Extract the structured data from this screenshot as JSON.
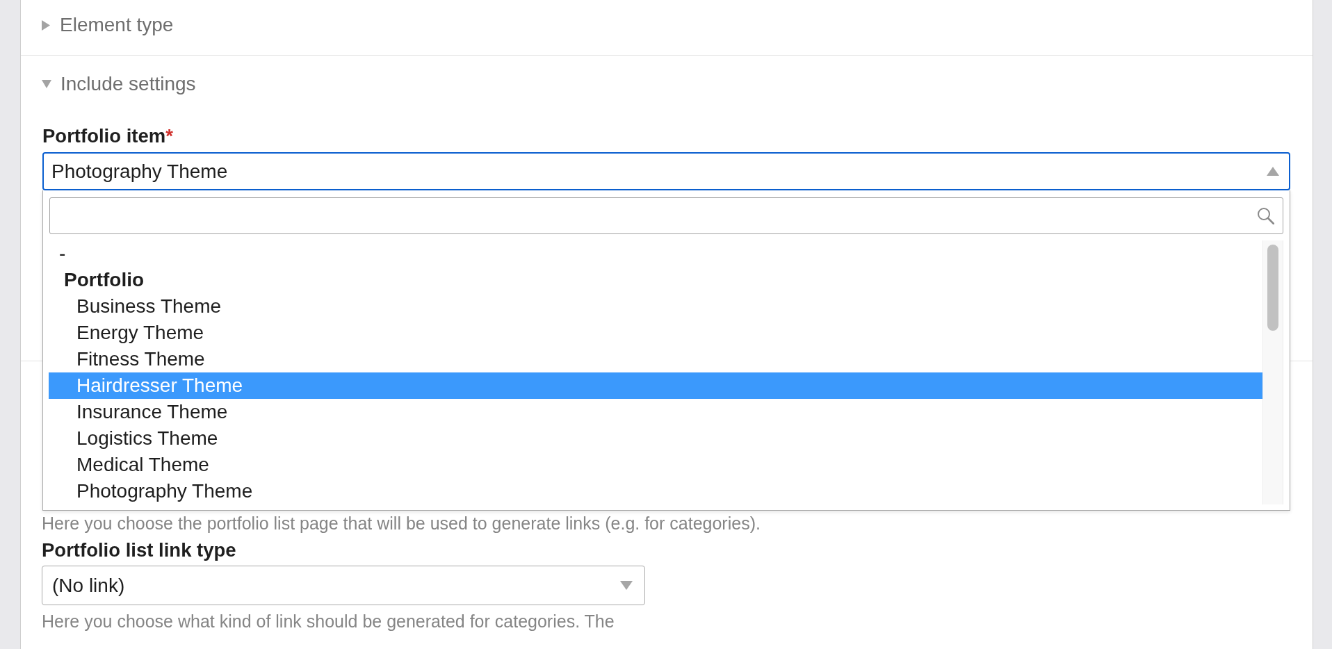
{
  "sections": [
    {
      "title": "Element type",
      "expanded": false
    },
    {
      "title": "Include settings",
      "expanded": true,
      "fields": [
        {
          "kind": "combobox",
          "label": "Portfolio item",
          "required_mark": "*",
          "value": "Photography Theme",
          "open": true,
          "options": [
            {
              "kind": "option",
              "label": "-",
              "selected": false
            },
            {
              "kind": "group",
              "label": "Portfolio",
              "children": [
                {
                  "label": "Business Theme",
                  "selected": false
                },
                {
                  "label": "Energy Theme",
                  "selected": false
                },
                {
                  "label": "Fitness Theme",
                  "selected": false
                },
                {
                  "label": "Hairdresser Theme",
                  "selected": true
                },
                {
                  "label": "Insurance Theme",
                  "selected": false
                },
                {
                  "label": "Logistics Theme",
                  "selected": false
                },
                {
                  "label": "Medical Theme",
                  "selected": false
                },
                {
                  "label": "Photography Theme",
                  "selected": false
                }
              ]
            }
          ]
        }
      ]
    },
    {
      "fields": [
        {
          "kind": "help",
          "help": "Here you choose the portfolio list page that will be used to generate links (e.g. for categories)."
        },
        {
          "kind": "select",
          "label": "Portfolio list link type",
          "value": "(No link)",
          "open": false,
          "help": "Here you choose what kind of link should be generated for categories. The"
        }
      ]
    }
  ]
}
